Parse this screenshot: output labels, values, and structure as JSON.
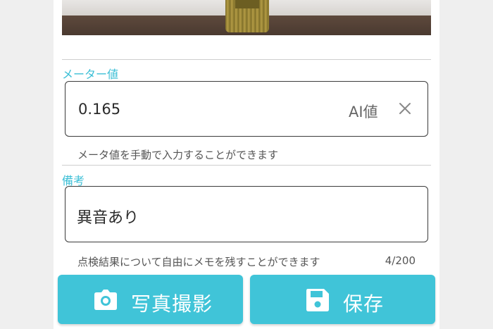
{
  "meter": {
    "label": "メーター値",
    "value": "0.165",
    "ai_badge": "AI値",
    "helper": "メータ値を手動で入力することができます",
    "clear_icon": "close-icon"
  },
  "memo": {
    "label": "備考",
    "value": "異音あり",
    "helper": "点検結果について自由にメモを残すことができます",
    "counter": "4/200"
  },
  "actions": {
    "photo": {
      "label": "写真撮影",
      "icon": "camera-icon"
    },
    "save": {
      "label": "保存",
      "icon": "floppy-disk-icon"
    }
  },
  "colors": {
    "accent": "#40c4d8",
    "label": "#3cbfd6",
    "background": "#efefef"
  }
}
